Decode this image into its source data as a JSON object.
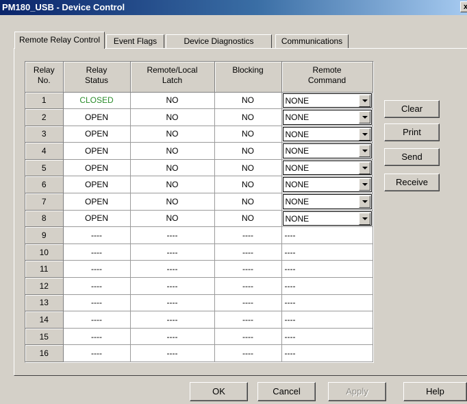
{
  "window": {
    "title": "PM180_USB - Device Control",
    "close_glyph": "x"
  },
  "tabs": [
    {
      "label": "Remote Relay Control"
    },
    {
      "label": "Event Flags"
    },
    {
      "label": "Device Diagnostics"
    },
    {
      "label": "Communications"
    }
  ],
  "table": {
    "headers": [
      "Relay\nNo.",
      "Relay\nStatus",
      "Remote/Local\nLatch",
      "Blocking",
      "Remote\nCommand"
    ],
    "rows": [
      {
        "no": "1",
        "status": "CLOSED",
        "latch": "NO",
        "blocking": "NO",
        "command": "NONE",
        "dropdown": true
      },
      {
        "no": "2",
        "status": "OPEN",
        "latch": "NO",
        "blocking": "NO",
        "command": "NONE",
        "dropdown": true
      },
      {
        "no": "3",
        "status": "OPEN",
        "latch": "NO",
        "blocking": "NO",
        "command": "NONE",
        "dropdown": true
      },
      {
        "no": "4",
        "status": "OPEN",
        "latch": "NO",
        "blocking": "NO",
        "command": "NONE",
        "dropdown": true
      },
      {
        "no": "5",
        "status": "OPEN",
        "latch": "NO",
        "blocking": "NO",
        "command": "NONE",
        "dropdown": true
      },
      {
        "no": "6",
        "status": "OPEN",
        "latch": "NO",
        "blocking": "NO",
        "command": "NONE",
        "dropdown": true
      },
      {
        "no": "7",
        "status": "OPEN",
        "latch": "NO",
        "blocking": "NO",
        "command": "NONE",
        "dropdown": true
      },
      {
        "no": "8",
        "status": "OPEN",
        "latch": "NO",
        "blocking": "NO",
        "command": "NONE",
        "dropdown": true
      },
      {
        "no": "9",
        "status": "----",
        "latch": "----",
        "blocking": "----",
        "command": "----",
        "dropdown": false
      },
      {
        "no": "10",
        "status": "----",
        "latch": "----",
        "blocking": "----",
        "command": "----",
        "dropdown": false
      },
      {
        "no": "11",
        "status": "----",
        "latch": "----",
        "blocking": "----",
        "command": "----",
        "dropdown": false
      },
      {
        "no": "12",
        "status": "----",
        "latch": "----",
        "blocking": "----",
        "command": "----",
        "dropdown": false
      },
      {
        "no": "13",
        "status": "----",
        "latch": "----",
        "blocking": "----",
        "command": "----",
        "dropdown": false
      },
      {
        "no": "14",
        "status": "----",
        "latch": "----",
        "blocking": "----",
        "command": "----",
        "dropdown": false
      },
      {
        "no": "15",
        "status": "----",
        "latch": "----",
        "blocking": "----",
        "command": "----",
        "dropdown": false
      },
      {
        "no": "16",
        "status": "----",
        "latch": "----",
        "blocking": "----",
        "command": "----",
        "dropdown": false
      }
    ]
  },
  "side_buttons": {
    "clear": "Clear",
    "print": "Print",
    "send": "Send",
    "receive": "Receive"
  },
  "footer_buttons": {
    "ok": "OK",
    "cancel": "Cancel",
    "apply": "Apply",
    "help": "Help"
  },
  "colors": {
    "closed_status": "#2a8c2a",
    "title_bar": "#0a246a",
    "face": "#d4d0c8"
  }
}
